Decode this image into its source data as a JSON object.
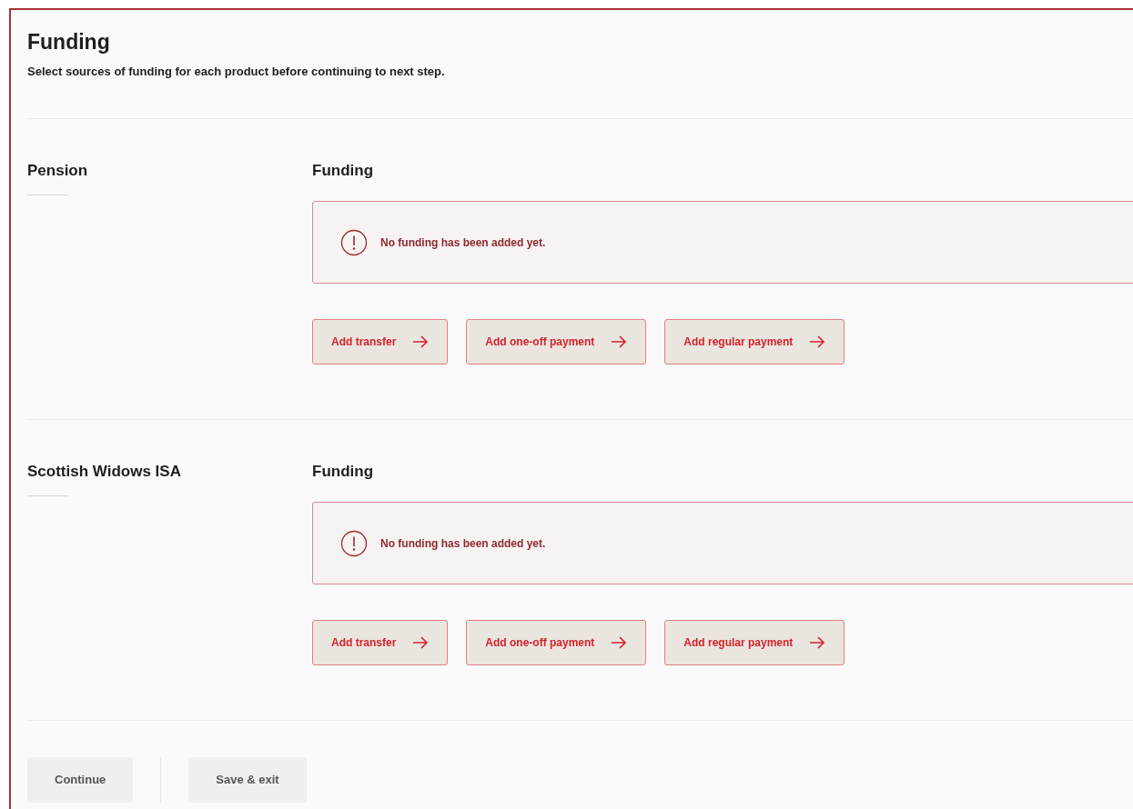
{
  "header": {
    "title": "Funding",
    "subtitle": "Select sources of funding for each product before continuing to next step."
  },
  "products": [
    {
      "name": "Pension",
      "funding_heading": "Funding",
      "alert": "No funding has been added yet.",
      "actions": [
        "Add transfer",
        "Add one-off payment",
        "Add regular payment"
      ]
    },
    {
      "name": "Scottish Widows ISA",
      "funding_heading": "Funding",
      "alert": "No funding has been added yet.",
      "actions": [
        "Add transfer",
        "Add one-off payment",
        "Add regular payment"
      ]
    }
  ],
  "footer_buttons": [
    "Continue",
    "Save & exit"
  ]
}
